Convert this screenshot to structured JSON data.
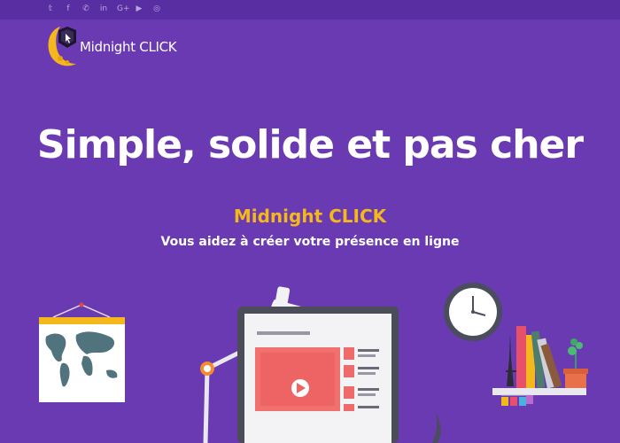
{
  "social": {
    "icons": [
      "twitter-icon",
      "facebook-icon",
      "whatsapp-icon",
      "linkedin-icon",
      "google-plus-icon",
      "youtube-icon",
      "instagram-icon"
    ],
    "glyphs": [
      "𝕥",
      "f",
      "✆",
      "in",
      "G+",
      "▶",
      "◎"
    ]
  },
  "header": {
    "brand": "Midnight CLICK"
  },
  "hero": {
    "headline": "Simple, solide et pas cher",
    "tagline": "Midnight CLICK",
    "subtitle": "Vous aidez à créer votre présence en ligne"
  },
  "colors": {
    "background": "#6a3ab3",
    "topbar": "#5a2ea3",
    "accent": "#f4b81c",
    "text": "#ffffff"
  }
}
